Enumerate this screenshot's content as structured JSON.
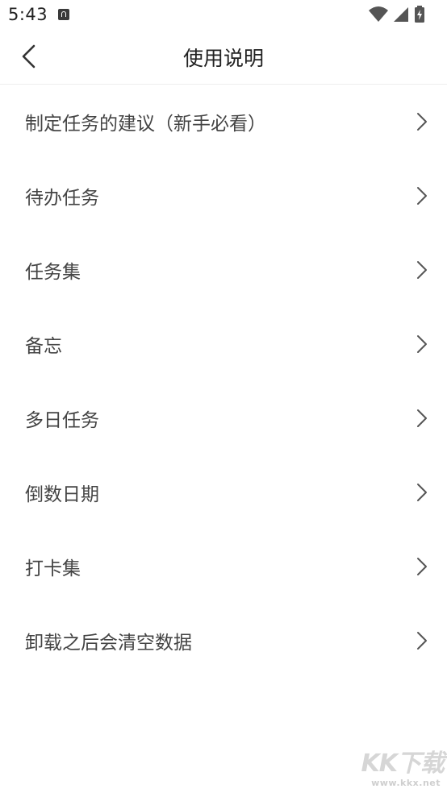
{
  "status_bar": {
    "time": "5:43",
    "notification_icon": "text-notification-icon",
    "icons": [
      "wifi-icon",
      "cellular-signal-icon",
      "battery-charging-icon"
    ]
  },
  "header": {
    "back_icon": "chevron-left-icon",
    "title": "使用说明"
  },
  "list": {
    "chevron_icon": "chevron-right-icon",
    "items": [
      {
        "label": "制定任务的建议（新手必看）"
      },
      {
        "label": "待办任务"
      },
      {
        "label": "任务集"
      },
      {
        "label": "备忘"
      },
      {
        "label": "多日任务"
      },
      {
        "label": "倒数日期"
      },
      {
        "label": "打卡集"
      },
      {
        "label": "卸载之后会清空数据"
      }
    ]
  },
  "watermark": {
    "logo": "KK下载",
    "url": "www.kkx.net"
  },
  "colors": {
    "background": "#ffffff",
    "title_text": "#222222",
    "item_text": "#444444",
    "chevron": "#555555",
    "divider": "#eeeeee"
  }
}
